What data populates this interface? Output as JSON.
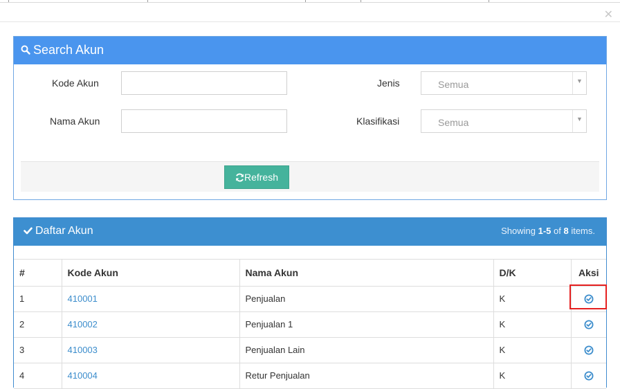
{
  "search_panel": {
    "title": "Search Akun",
    "kode_label": "Kode Akun",
    "nama_label": "Nama Akun",
    "jenis_label": "Jenis",
    "jenis_value": "Semua",
    "klasifikasi_label": "Klasifikasi",
    "klasifikasi_value": "Semua",
    "refresh_label": "Refresh"
  },
  "list_panel": {
    "title": "Daftar Akun",
    "showing_prefix": "Showing ",
    "showing_range": "1-5",
    "showing_mid": " of ",
    "showing_total": "8",
    "showing_suffix": " items."
  },
  "table": {
    "headers": [
      "#",
      "Kode Akun",
      "Nama Akun",
      "D/K",
      "Aksi"
    ],
    "rows": [
      {
        "no": "1",
        "kode": "410001",
        "nama": "Penjualan",
        "dk": "K"
      },
      {
        "no": "2",
        "kode": "410002",
        "nama": "Penjualan 1",
        "dk": "K"
      },
      {
        "no": "3",
        "kode": "410003",
        "nama": "Penjualan Lain",
        "dk": "K"
      },
      {
        "no": "4",
        "kode": "410004",
        "nama": "Retur Penjualan",
        "dk": "K"
      }
    ]
  },
  "icons": {
    "search": "search-icon",
    "refresh": "refresh-icon",
    "check": "check-icon",
    "select_action": "check-circle-icon",
    "close": "close-icon"
  },
  "colors": {
    "search_header": "#4a95ee",
    "list_header": "#3d8fd0",
    "refresh_button": "#45b39c",
    "link": "#3c8dcc",
    "highlight": "#e51f1f"
  }
}
